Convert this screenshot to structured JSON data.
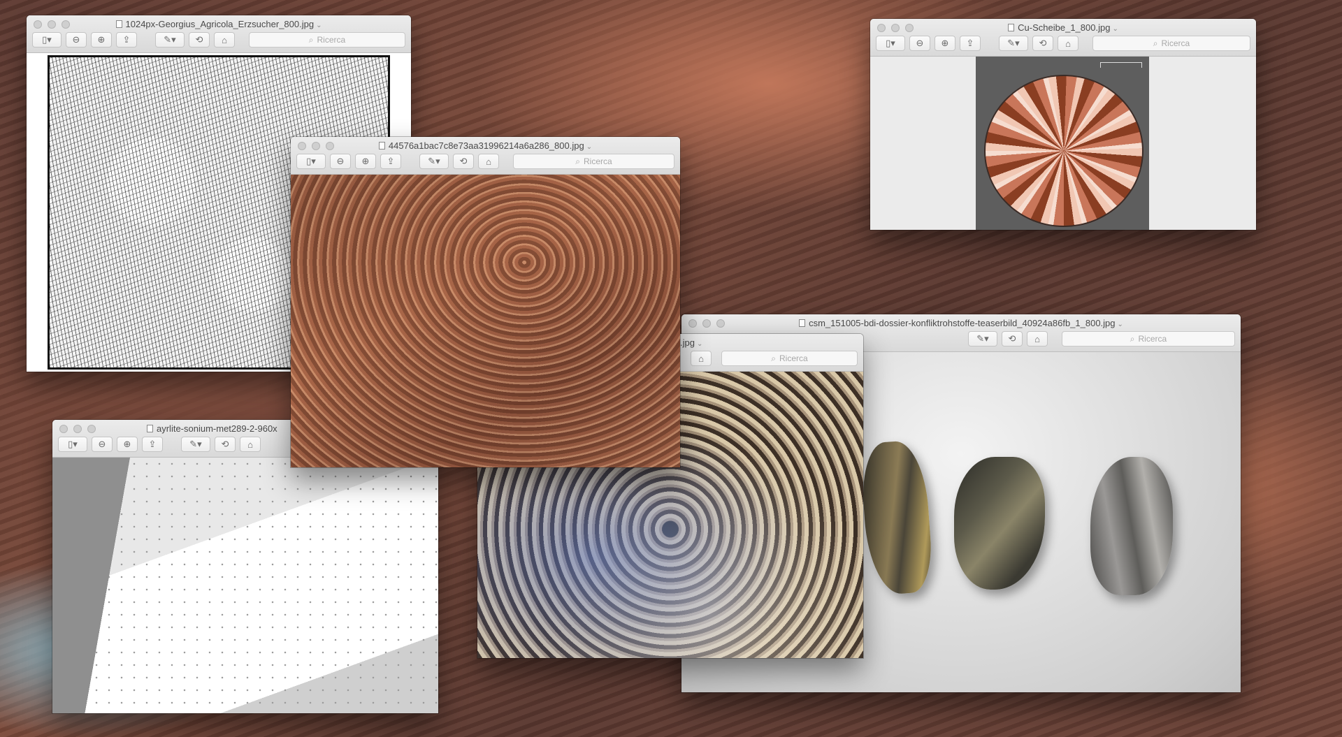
{
  "toolbar": {
    "search_placeholder": "Ricerca",
    "icons": {
      "sidebar": "▯▾",
      "zoom_out": "⊖",
      "zoom_in": "⊕",
      "share": "⇪",
      "markup": "✎▾",
      "rotate": "⟲",
      "toolbox": "⌂"
    }
  },
  "windows": {
    "agricola": {
      "title": "1024px-Georgius_Agricola_Erzsucher_800.jpg"
    },
    "cu_scheibe": {
      "title": "Cu-Scheibe_1_800.jpg"
    },
    "mine": {
      "title": "44576a1bac7c8e73aa31996214a6a286_800.jpg"
    },
    "ayrlite": {
      "title": "ayrlite-sonium-met289-2-960x"
    },
    "tunnel": {
      "title": ".jpg"
    },
    "minerals": {
      "title": "csm_151005-bdi-dossier-konfliktrohstoffe-teaserbild_40924a86fb_1_800.jpg"
    }
  }
}
